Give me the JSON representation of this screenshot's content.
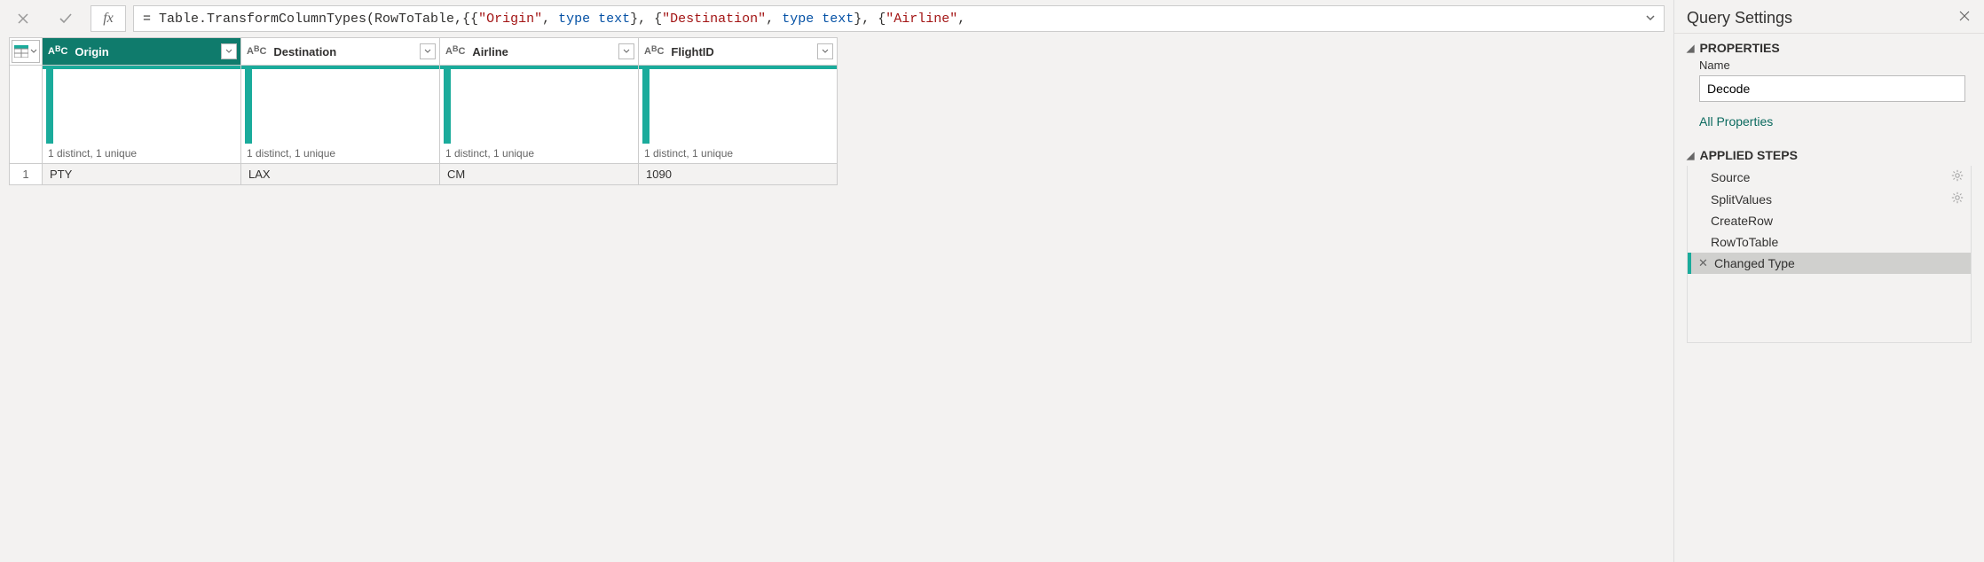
{
  "formula_bar": {
    "formula_plain": "= Table.TransformColumnTypes(RowToTable,{{\"Origin\", type text}, {\"Destination\", type text}, {\"Airline\",",
    "prefix": "= Table.TransformColumnTypes(RowToTable,{{",
    "parts": [
      {
        "t": "str",
        "v": "\"Origin\""
      },
      {
        "t": "plain",
        "v": ", "
      },
      {
        "t": "kw",
        "v": "type"
      },
      {
        "t": "plain",
        "v": " "
      },
      {
        "t": "kw",
        "v": "text"
      },
      {
        "t": "plain",
        "v": "}, {"
      },
      {
        "t": "str",
        "v": "\"Destination\""
      },
      {
        "t": "plain",
        "v": ", "
      },
      {
        "t": "kw",
        "v": "type"
      },
      {
        "t": "plain",
        "v": " "
      },
      {
        "t": "kw",
        "v": "text"
      },
      {
        "t": "plain",
        "v": "}, {"
      },
      {
        "t": "str",
        "v": "\"Airline\""
      },
      {
        "t": "plain",
        "v": ","
      }
    ],
    "fx_label": "fx"
  },
  "columns": [
    {
      "name": "Origin",
      "type_label": "ABC",
      "selected": true,
      "quality": "1 distinct, 1 unique"
    },
    {
      "name": "Destination",
      "type_label": "ABC",
      "selected": false,
      "quality": "1 distinct, 1 unique"
    },
    {
      "name": "Airline",
      "type_label": "ABC",
      "selected": false,
      "quality": "1 distinct, 1 unique"
    },
    {
      "name": "FlightID",
      "type_label": "ABC",
      "selected": false,
      "quality": "1 distinct, 1 unique"
    }
  ],
  "rows": [
    {
      "index": "1",
      "cells": [
        "PTY",
        "LAX",
        "CM",
        "1090"
      ]
    }
  ],
  "settings": {
    "panel_title": "Query Settings",
    "properties_label": "PROPERTIES",
    "name_label": "Name",
    "name_value": "Decode",
    "all_properties_link": "All Properties",
    "applied_steps_label": "APPLIED STEPS",
    "steps": [
      {
        "label": "Source",
        "has_gear": true,
        "selected": false
      },
      {
        "label": "SplitValues",
        "has_gear": true,
        "selected": false
      },
      {
        "label": "CreateRow",
        "has_gear": false,
        "selected": false
      },
      {
        "label": "RowToTable",
        "has_gear": false,
        "selected": false
      },
      {
        "label": "Changed Type",
        "has_gear": false,
        "selected": true
      }
    ]
  }
}
